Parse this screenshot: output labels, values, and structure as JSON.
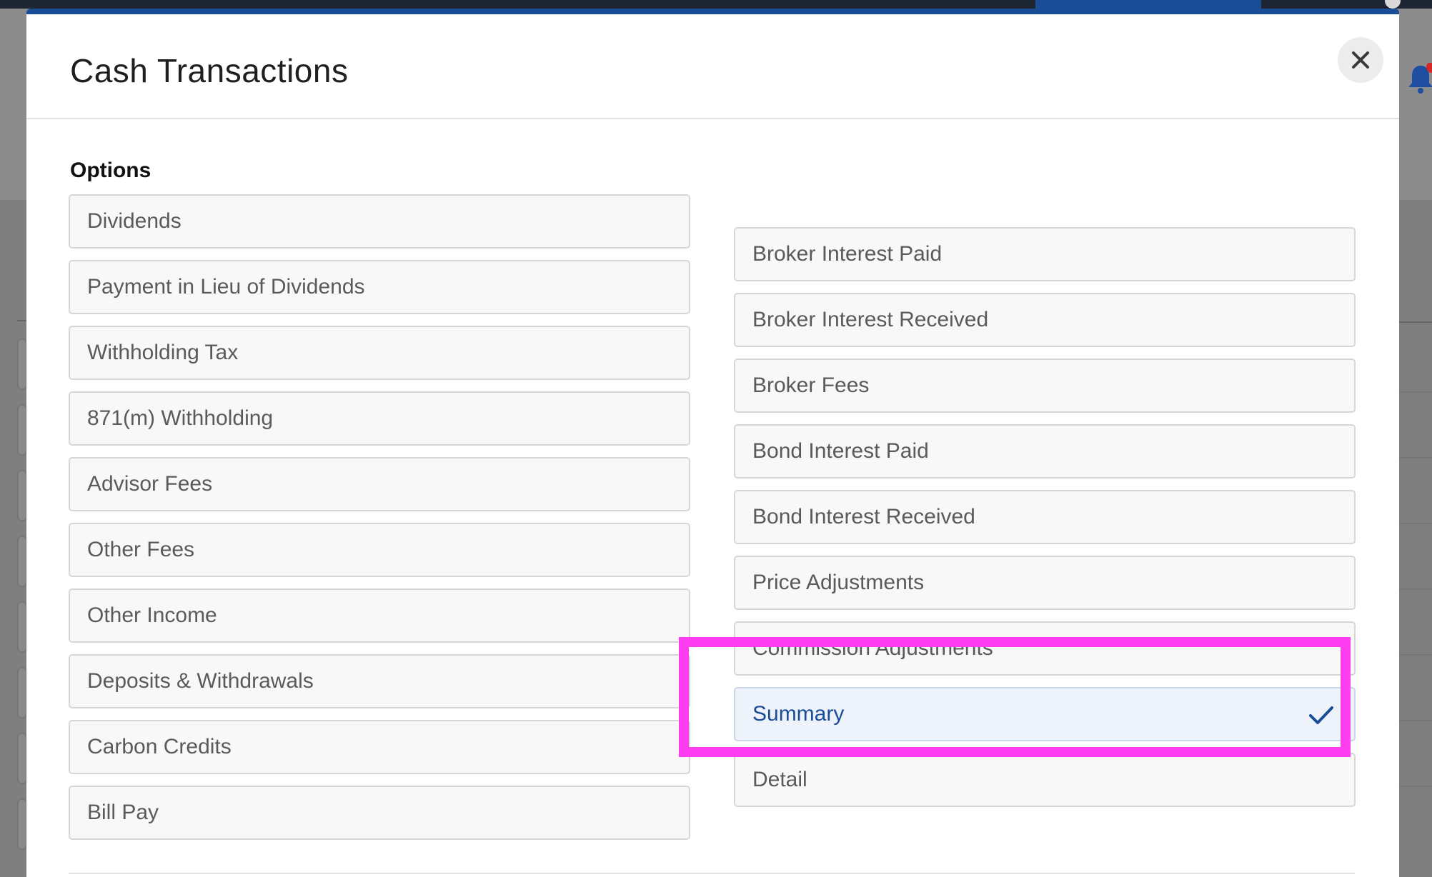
{
  "modal": {
    "title": "Cash Transactions",
    "close_icon": "close-icon",
    "section_label": "Options"
  },
  "options_left": [
    {
      "label": "Dividends"
    },
    {
      "label": "Payment in Lieu of Dividends"
    },
    {
      "label": "Withholding Tax"
    },
    {
      "label": "871(m) Withholding"
    },
    {
      "label": "Advisor Fees"
    },
    {
      "label": "Other Fees"
    },
    {
      "label": "Other Income"
    },
    {
      "label": "Deposits & Withdrawals"
    },
    {
      "label": "Carbon Credits"
    },
    {
      "label": "Bill Pay"
    }
  ],
  "options_right": [
    {
      "label": "Broker Interest Paid"
    },
    {
      "label": "Broker Interest Received"
    },
    {
      "label": "Broker Fees"
    },
    {
      "label": "Bond Interest Paid"
    },
    {
      "label": "Bond Interest Received"
    },
    {
      "label": "Price Adjustments"
    },
    {
      "label": "Commission Adjustments"
    },
    {
      "label": "Summary",
      "selected": true,
      "icon": "checkmark-icon"
    },
    {
      "label": "Detail"
    }
  ],
  "colors": {
    "accent": "#1a4d96",
    "highlight": "#ff3df0",
    "selected_bg": "#eef3fb"
  }
}
